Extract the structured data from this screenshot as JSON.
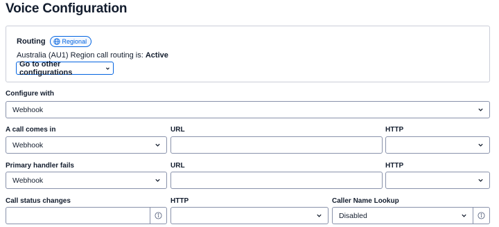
{
  "page": {
    "title": "Voice Configuration"
  },
  "routing": {
    "title": "Routing",
    "badge": "Regional",
    "status_prefix": "Australia (AU1) Region call routing is: ",
    "status_value": "Active",
    "other_button": "Go to other configurations"
  },
  "configure_with": {
    "label": "Configure with",
    "value": "Webhook"
  },
  "call_comes_in": {
    "label": "A call comes in",
    "value": "Webhook",
    "url_label": "URL",
    "url_value": "",
    "http_label": "HTTP",
    "http_value": ""
  },
  "primary_fails": {
    "label": "Primary handler fails",
    "value": "Webhook",
    "url_label": "URL",
    "url_value": "",
    "http_label": "HTTP",
    "http_value": ""
  },
  "status_changes": {
    "label": "Call status changes",
    "value": "",
    "http_label": "HTTP",
    "http_value": "",
    "lookup_label": "Caller Name Lookup",
    "lookup_value": "Disabled"
  },
  "icons": {
    "globe": "globe-icon",
    "chevron": "chevron-down-icon",
    "info": "info-icon"
  },
  "colors": {
    "accent": "#0263e0",
    "text": "#121c2d",
    "border": "#8891aa"
  }
}
